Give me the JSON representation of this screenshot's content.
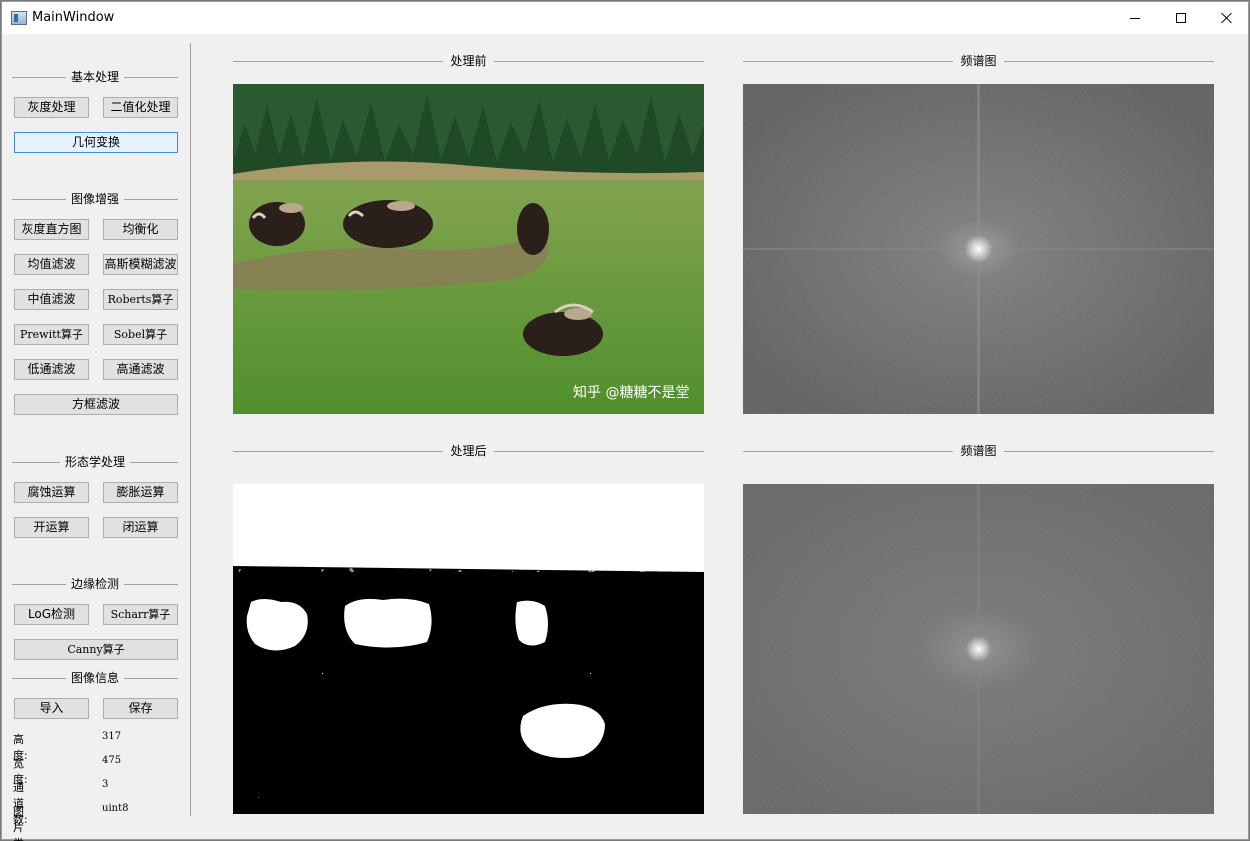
{
  "window": {
    "title": "MainWindow"
  },
  "sidebar": {
    "basic": {
      "title": "基本处理",
      "buttons": [
        "灰度处理",
        "二值化处理",
        "几何变换"
      ]
    },
    "enhance": {
      "title": "图像增强",
      "buttons": [
        "灰度直方图",
        "均衡化",
        "均值滤波",
        "高斯模糊滤波",
        "中值滤波",
        "Roberts算子",
        "Prewitt算子",
        "Sobel算子",
        "低通滤波",
        "高通滤波",
        "方框滤波"
      ]
    },
    "morph": {
      "title": "形态学处理",
      "buttons": [
        "腐蚀运算",
        "膨胀运算",
        "开运算",
        "闭运算"
      ]
    },
    "edge": {
      "title": "边缘检测",
      "buttons": [
        "LoG检测",
        "Scharr算子",
        "Canny算子"
      ]
    },
    "info": {
      "title": "图像信息",
      "buttons": [
        "导入",
        "保存"
      ],
      "rows": [
        {
          "key": "高度:",
          "value": "317"
        },
        {
          "key": "宽度:",
          "value": "475"
        },
        {
          "key": "通道数:",
          "value": "3"
        },
        {
          "key": "图片类型:",
          "value": "uint8"
        }
      ]
    }
  },
  "panels": {
    "before_title": "处理前",
    "before_spectrum_title": "频谱图",
    "after_title": "处理后",
    "after_spectrum_title": "频谱图",
    "watermark": "知乎 @糖糖不是堂"
  },
  "colors": {
    "window_bg": "#f0f0f0",
    "button_bg": "#e1e1e1",
    "button_border": "#adadad",
    "focus_border": "#3c8ce0",
    "spectrum_gray": "#6b6b6b",
    "grass_green": "#5e9a3a",
    "forest_green": "#2a5a2e"
  },
  "icons": {
    "app": "app-window-icon",
    "minimize": "minimize-icon",
    "maximize": "maximize-icon",
    "close": "close-icon"
  }
}
